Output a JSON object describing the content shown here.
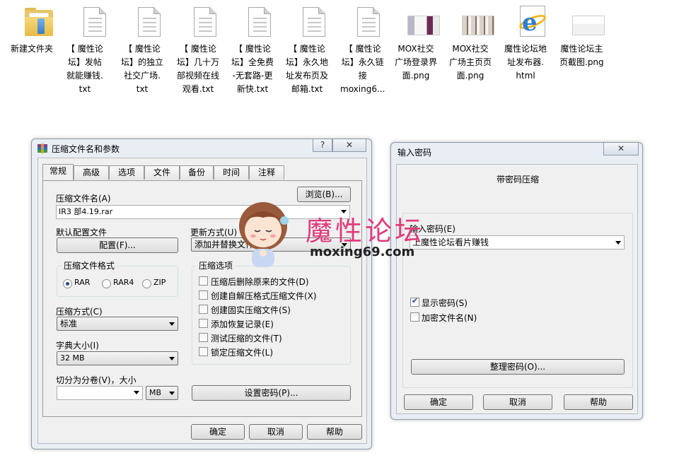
{
  "desktop": {
    "files": [
      {
        "name": "新建文件夹",
        "icon": "folder-icon"
      },
      {
        "name": "【 魔性论坛】发帖就能赚钱.txt",
        "icon": "text-file-icon"
      },
      {
        "name": "【 魔性论坛】的独立社交广场.txt",
        "icon": "text-file-icon"
      },
      {
        "name": "【 魔性论坛】几十万部视频在线观看.txt",
        "icon": "text-file-icon"
      },
      {
        "name": "【 魔性论坛】全免费-无套路-更新快.txt",
        "icon": "text-file-icon"
      },
      {
        "name": "【 魔性论坛】永久地址发布页及邮箱.txt",
        "icon": "text-file-icon"
      },
      {
        "name": "【 魔性论坛】永久链接moxing6...",
        "icon": "text-file-icon"
      },
      {
        "name": "MOX社交广场登录界面.png",
        "icon": "image-file-icon"
      },
      {
        "name": "MOX社交广场主页页面.png",
        "icon": "image-file-icon"
      },
      {
        "name": "魔性论坛地址发布器.html",
        "icon": "ie-html-icon"
      },
      {
        "name": "魔性论坛主页截图.png",
        "icon": "image-file-icon"
      }
    ],
    "labels": [
      "新建文件夹",
      "【 魔性论\n坛】发帖\n就能赚钱.\ntxt",
      "【 魔性论\n坛】的独立\n社交广场.\ntxt",
      "【 魔性论\n坛】几十万\n部视频在线\n观看.txt",
      "【 魔性论\n坛】全免费\n-无套路-更\n新快.txt",
      "【 魔性论\n坛】永久地\n址发布页及\n邮箱.txt",
      "【 魔性论\n坛】永久链\n接\nmoxing6...",
      "MOX社交\n广场登录界\n面.png",
      "MOX社交\n广场主页页\n面.png",
      "魔性论坛地\n址发布器.\nhtml",
      "魔性论坛主\n页截图.png"
    ]
  },
  "archive_dialog": {
    "title": "压缩文件名和参数",
    "help_glyph": "?",
    "close_glyph": "✕",
    "tabs": [
      "常规",
      "高级",
      "选项",
      "文件",
      "备份",
      "时间",
      "注释"
    ],
    "archive_name_label": "压缩文件名(A)",
    "archive_name_value": "IR3 部4.19.rar",
    "browse_button": "浏览(B)...",
    "default_profile_label": "默认配置文件",
    "profiles_button": "配置(F)...",
    "update_mode_label": "更新方式(U)",
    "update_mode_value": "添加并替换文件",
    "format_group_title": "压缩文件格式",
    "formats": [
      {
        "label": "RAR",
        "checked": true
      },
      {
        "label": "RAR4",
        "checked": false
      },
      {
        "label": "ZIP",
        "checked": false
      }
    ],
    "method_label": "压缩方式(C)",
    "method_value": "标准",
    "dict_label": "字典大小(I)",
    "dict_value": "32 MB",
    "split_label": "切分为分卷(V)，大小",
    "split_value": "",
    "split_unit": "MB",
    "options_group_title": "压缩选项",
    "options": [
      {
        "label": "压缩后删除原来的文件(D)",
        "checked": false
      },
      {
        "label": "创建自解压格式压缩文件(X)",
        "checked": false
      },
      {
        "label": "创建固实压缩文件(S)",
        "checked": false
      },
      {
        "label": "添加恢复记录(E)",
        "checked": false
      },
      {
        "label": "测试压缩的文件(T)",
        "checked": false
      },
      {
        "label": "锁定压缩文件(L)",
        "checked": false
      }
    ],
    "set_password_button": "设置密码(P)...",
    "ok_button": "确定",
    "cancel_button": "取消",
    "help_button": "帮助"
  },
  "password_dialog": {
    "title": "输入密码",
    "close_glyph": "✕",
    "heading": "带密码压缩",
    "password_label": "输入密码(E)",
    "password_value": "上魔性论坛看片赚钱",
    "show_password_label": "显示密码(S)",
    "show_password_checked": true,
    "encrypt_names_label": "加密文件名(N)",
    "encrypt_names_checked": false,
    "organize_button": "整理密码(O)...",
    "ok_button": "确定",
    "cancel_button": "取消",
    "help_button": "帮助"
  },
  "watermark": {
    "text": "魔性论坛",
    "url": "moxing69.com"
  },
  "colors": {
    "watermark_pink": "#e23b7b",
    "checkmark_blue": "#214a9c"
  }
}
